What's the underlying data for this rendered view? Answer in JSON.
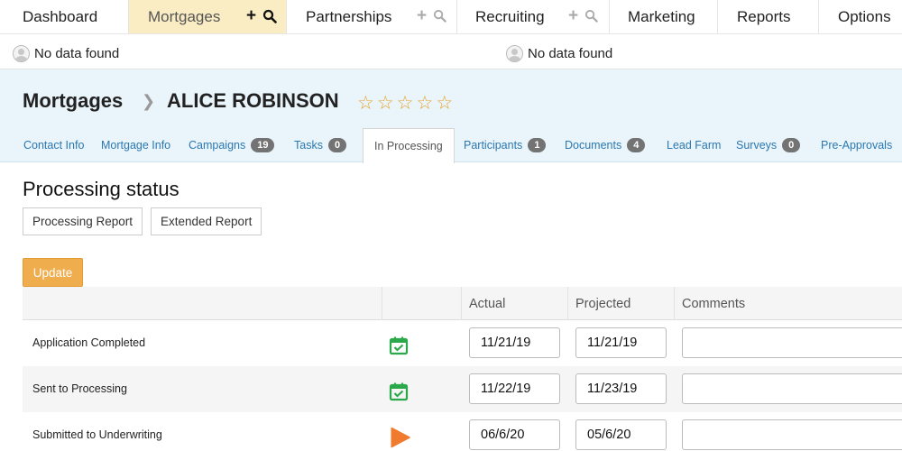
{
  "topnav": {
    "dashboard": "Dashboard",
    "mortgages": "Mortgages",
    "partnerships": "Partnerships",
    "recruiting": "Recruiting",
    "marketing": "Marketing",
    "reports": "Reports",
    "options": "Options"
  },
  "users": {
    "left": "No data found",
    "right": "No data found"
  },
  "header": {
    "section": "Mortgages",
    "contact_name": "ALICE ROBINSON",
    "rating": 0,
    "rating_max": 5
  },
  "subtabs": [
    {
      "label": "Contact Info"
    },
    {
      "label": "Mortgage Info"
    },
    {
      "label": "Campaigns",
      "badge": "19"
    },
    {
      "label": "Tasks",
      "badge": "0"
    },
    {
      "label": "In Processing"
    },
    {
      "label": "Participants",
      "badge": "1"
    },
    {
      "label": "Documents",
      "badge": "4"
    },
    {
      "label": "Lead Farm"
    },
    {
      "label": "Surveys",
      "badge": "0"
    },
    {
      "label": "Pre-Approvals"
    }
  ],
  "main": {
    "title": "Processing status",
    "processing_report": "Processing Report",
    "extended_report": "Extended Report",
    "update": "Update"
  },
  "table": {
    "headers": [
      "",
      "",
      "Actual",
      "Projected",
      "Comments"
    ],
    "rows": [
      {
        "label": "Application Completed",
        "status": "completed",
        "actual": "11/21/19",
        "projected": "11/21/19",
        "comments": ""
      },
      {
        "label": "Sent to Processing",
        "status": "completed",
        "actual": "11/22/19",
        "projected": "11/23/19",
        "comments": ""
      },
      {
        "label": "Submitted to Underwriting",
        "status": "in-progress",
        "actual": "06/6/20",
        "projected": "05/6/20",
        "comments": ""
      }
    ]
  },
  "colors": {
    "active_tab": "#fbedc3",
    "header_bg": "#e9f4fb",
    "link": "#2c78b0",
    "update_button": "#f0ad4e",
    "star": "#e7a224",
    "completed_icon": "#2aa84a",
    "in_progress_icon": "#f07a2e"
  }
}
